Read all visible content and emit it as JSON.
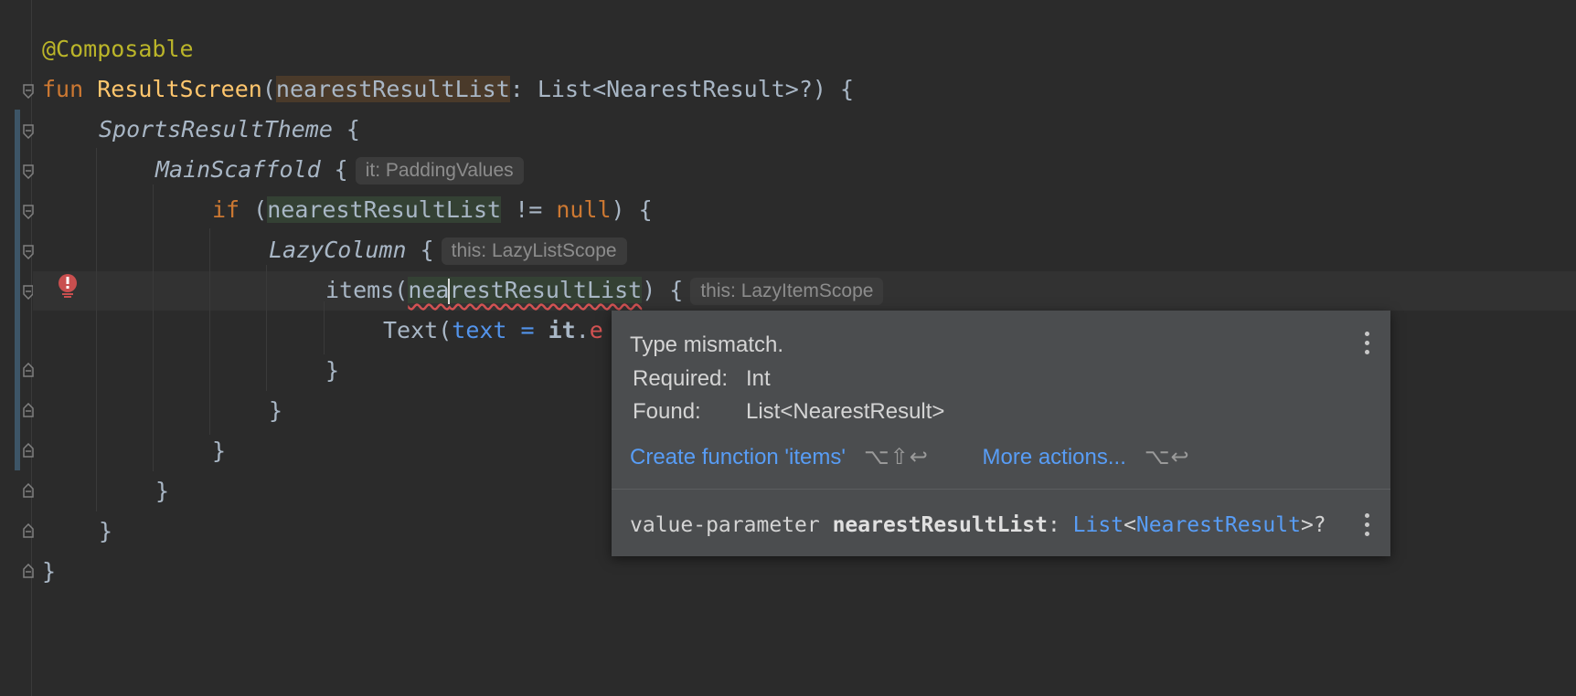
{
  "editor": {
    "lines": [
      {
        "annotation": "@Composable"
      },
      {
        "kw": "fun",
        "name": "ResultScreen",
        "open": "(",
        "param": "nearestResultList",
        "rest": ": List<NearestResult>?) {"
      },
      {
        "name": "SportsResultTheme",
        "rest": " {"
      },
      {
        "name": "MainScaffold",
        "rest": " {",
        "hint": "it: PaddingValues"
      },
      {
        "kw": "if",
        "open": " (",
        "ref": "nearestResultList",
        "mid": " != ",
        "kw2": "null",
        "rest": ") {"
      },
      {
        "name": "LazyColumn",
        "rest": " {",
        "hint": "this: LazyListScope"
      },
      {
        "call": "items(",
        "ref_a": "nea",
        "ref_b": "restResultList",
        "rest": ") {",
        "hint": "this: LazyItemScope"
      },
      {
        "call": "Text(",
        "named": "text = ",
        "kw": "it",
        "rest": ".",
        "err": "e"
      },
      {
        "rest": "}"
      },
      {
        "rest": "}"
      },
      {
        "rest": "}"
      },
      {
        "rest": "}"
      },
      {
        "rest": "}"
      },
      {
        "rest": "}"
      }
    ]
  },
  "popup": {
    "title": "Type mismatch.",
    "required_label": "Required:",
    "required_value": "Int",
    "found_label": "Found:",
    "found_value": "List<NearestResult>",
    "action1": "Create function 'items'",
    "action1_shortcut": "⌥⇧↩",
    "action2": "More actions...",
    "action2_shortcut": "⌥↩",
    "doc_prefix": "value-parameter ",
    "doc_name": "nearestResultList",
    "doc_colon": ": ",
    "doc_type1": "List",
    "doc_lt": "<",
    "doc_type2": "NearestResult",
    "doc_suffix": ">?"
  },
  "colors": {
    "background": "#2b2b2b",
    "keyword": "#cc7832",
    "function": "#ffc66d",
    "annotation": "#bbb529",
    "link": "#589df6",
    "error": "#d25252"
  },
  "icons": [
    "error-icon",
    "fold-marker-icon",
    "kebab-menu-icon"
  ]
}
